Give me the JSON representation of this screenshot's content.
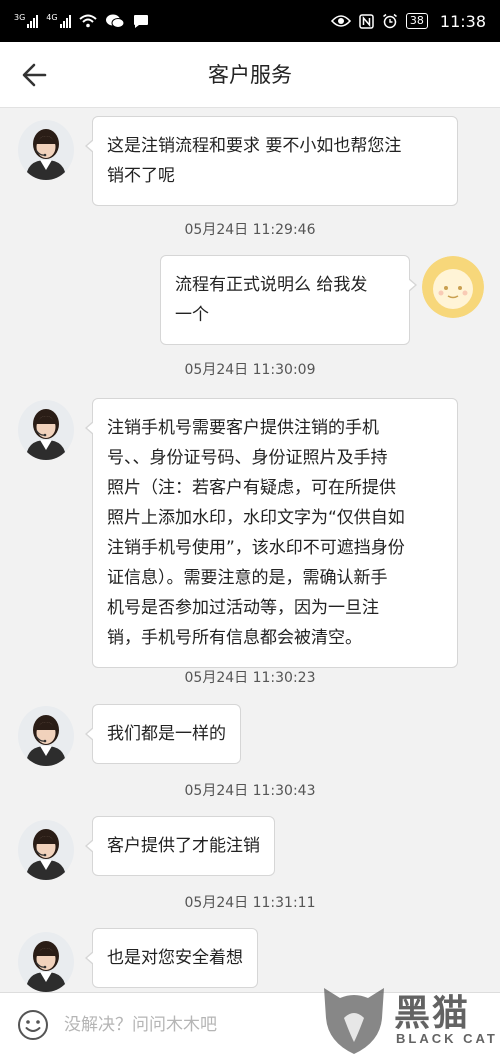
{
  "status_bar": {
    "sim1": "3G",
    "sim2": "4G",
    "battery": "38",
    "time": "11:38"
  },
  "header": {
    "title": "客户服务"
  },
  "messages": [
    {
      "side": "left",
      "lines": [
        "这是注销流程和要求 要不小如也帮您注",
        "销不了呢"
      ]
    },
    {
      "side": "right",
      "lines": [
        "流程有正式说明么 给我发",
        "一个"
      ]
    },
    {
      "side": "left",
      "lines": [
        "注销手机号需要客户提供注销的手机",
        "号、、身份证号码、身份证照片及手持",
        "照片（注：若客户有疑虑，可在所提供",
        "照片上添加水印，水印文字为“仅供自如",
        "注销手机号使用”，该水印不可遮挡身份",
        "证信息）。需要注意的是，需确认新手",
        "机号是否参加过活动等，因为一旦注",
        "销，手机号所有信息都会被清空。"
      ]
    },
    {
      "side": "left",
      "lines": [
        "我们都是一样的"
      ]
    },
    {
      "side": "left",
      "lines": [
        "客户提供了才能注销"
      ]
    },
    {
      "side": "left",
      "lines": [
        "也是对您安全着想"
      ]
    }
  ],
  "timestamps": [
    "05月24日 11:29:46",
    "05月24日 11:30:09",
    "05月24日 11:30:23",
    "05月24日 11:30:43",
    "05月24日 11:31:11"
  ],
  "input_bar": {
    "placeholder": "没解决？问问木木吧"
  },
  "watermark": {
    "chinese": "黑猫",
    "english": "BLACK CAT"
  },
  "colors": {
    "background": "#f2f2f2",
    "bubble": "#ffffff",
    "bubble_border": "#d6d6d6",
    "user_avatar": "#f7d77a",
    "status_bar": "#000000"
  },
  "icons": {
    "back": "arrow-left-icon",
    "emoji": "smiley-icon",
    "user_avatar": "cartoon-face-avatar",
    "agent_avatar": "headset-agent-avatar"
  }
}
